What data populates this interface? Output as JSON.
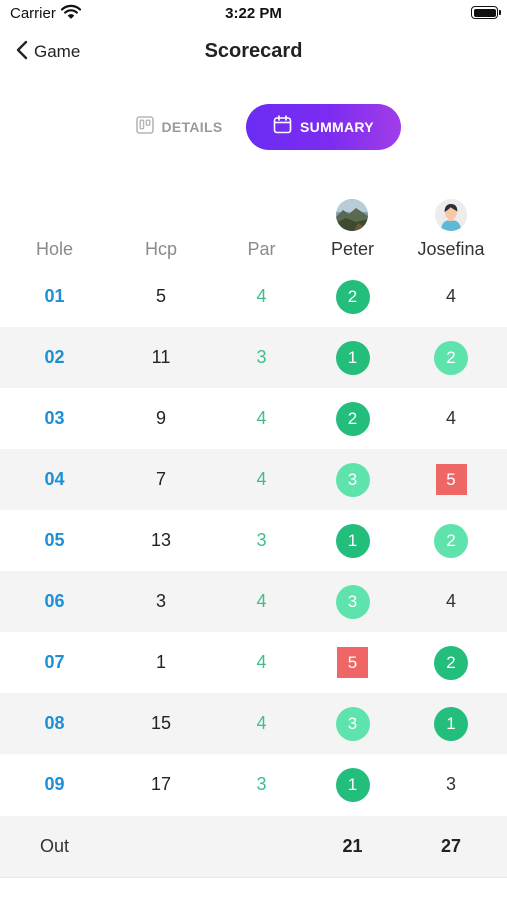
{
  "status_bar": {
    "carrier": "Carrier",
    "time": "3:22 PM"
  },
  "nav": {
    "back_label": "Game",
    "title": "Scorecard"
  },
  "tabs": [
    {
      "label": "DETAILS",
      "icon": "board-icon",
      "active": false
    },
    {
      "label": "SUMMARY",
      "icon": "calendar-icon",
      "active": true
    }
  ],
  "columns": {
    "hole": "Hole",
    "hcp": "Hcp",
    "par": "Par"
  },
  "players": [
    {
      "name": "Peter",
      "avatar": "landscape-photo-avatar"
    },
    {
      "name": "Josefina",
      "avatar": "female-person-avatar"
    }
  ],
  "holes": [
    {
      "hole": "01",
      "hcp": "5",
      "par": "4",
      "scores": [
        {
          "value": "2",
          "style": "dark"
        },
        {
          "value": "4",
          "style": "plain"
        }
      ]
    },
    {
      "hole": "02",
      "hcp": "11",
      "par": "3",
      "scores": [
        {
          "value": "1",
          "style": "dark"
        },
        {
          "value": "2",
          "style": "light"
        }
      ]
    },
    {
      "hole": "03",
      "hcp": "9",
      "par": "4",
      "scores": [
        {
          "value": "2",
          "style": "dark"
        },
        {
          "value": "4",
          "style": "plain"
        }
      ]
    },
    {
      "hole": "04",
      "hcp": "7",
      "par": "4",
      "scores": [
        {
          "value": "3",
          "style": "light"
        },
        {
          "value": "5",
          "style": "red"
        }
      ]
    },
    {
      "hole": "05",
      "hcp": "13",
      "par": "3",
      "scores": [
        {
          "value": "1",
          "style": "dark"
        },
        {
          "value": "2",
          "style": "light"
        }
      ]
    },
    {
      "hole": "06",
      "hcp": "3",
      "par": "4",
      "scores": [
        {
          "value": "3",
          "style": "light"
        },
        {
          "value": "4",
          "style": "plain"
        }
      ]
    },
    {
      "hole": "07",
      "hcp": "1",
      "par": "4",
      "scores": [
        {
          "value": "5",
          "style": "red"
        },
        {
          "value": "2",
          "style": "dark"
        }
      ]
    },
    {
      "hole": "08",
      "hcp": "15",
      "par": "4",
      "scores": [
        {
          "value": "3",
          "style": "light"
        },
        {
          "value": "1",
          "style": "dark"
        }
      ]
    },
    {
      "hole": "09",
      "hcp": "17",
      "par": "3",
      "scores": [
        {
          "value": "1",
          "style": "dark"
        },
        {
          "value": "3",
          "style": "plain"
        }
      ]
    }
  ],
  "totals": {
    "label": "Out",
    "values": [
      "21",
      "27"
    ]
  },
  "colors": {
    "hole_number": "#1c8fd6",
    "par": "#3fbf86",
    "badge_dark": "#23bd7c",
    "badge_light": "#5fe3ad",
    "badge_red": "#ee6666",
    "summary_gradient_start": "#6b2cf4",
    "summary_gradient_end": "#a13de8"
  }
}
